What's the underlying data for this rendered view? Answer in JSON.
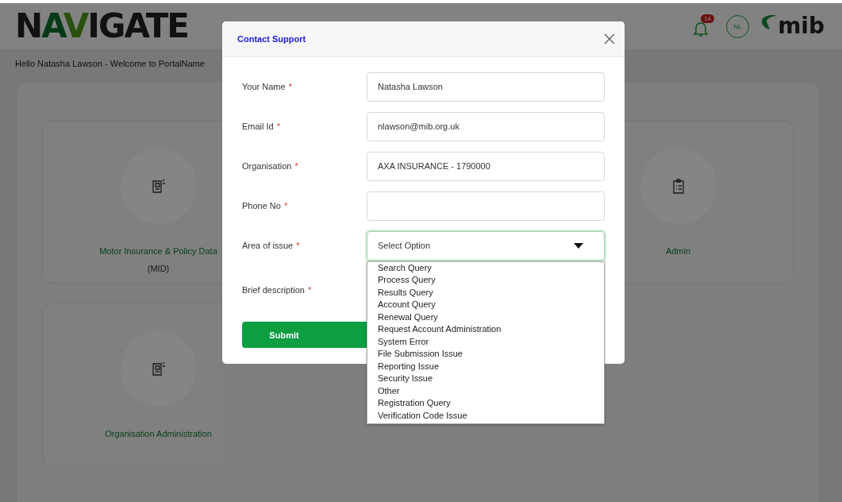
{
  "header": {
    "logo": "NAVIGATE",
    "notifications": {
      "count": "14"
    },
    "avatar": "NL",
    "brand": "mib"
  },
  "greeting": "Hello Natasha Lawson - Welcome to PortalName",
  "tiles": [
    {
      "label": "Motor Insurance & Policy Data",
      "sublabel": "(MID)"
    },
    {
      "label": "Admin"
    },
    {
      "label": "Organisation Administration"
    }
  ],
  "dialog": {
    "title": "Contact Support",
    "fields": [
      {
        "kind": "text",
        "label": "Your Name",
        "required_mark": "*",
        "value": "Natasha Lawson"
      },
      {
        "kind": "text",
        "label": "Email Id",
        "required_mark": "*",
        "value": "nlawson@mib.org.uk"
      },
      {
        "kind": "text",
        "label": "Organisation",
        "required_mark": "*",
        "value": "AXA INSURANCE - 1790000"
      },
      {
        "kind": "text",
        "label": "Phone No",
        "required_mark": "*"
      },
      {
        "kind": "select",
        "label": "Area of issue",
        "required_mark": "*",
        "placeholder": "Select Option",
        "expanded": true,
        "options": [
          "Search Query",
          "Process Query",
          "Results Query",
          "Account Query",
          "Renewal Query",
          "Request Account Administration",
          "System Error",
          "File Submission Issue",
          "Reporting Issue",
          "Security Issue",
          "Other",
          "Registration Query",
          "Verification Code Issue"
        ]
      },
      {
        "kind": "textarea",
        "label": "Brief description",
        "required_mark": "*"
      }
    ],
    "submit": "Submit"
  }
}
